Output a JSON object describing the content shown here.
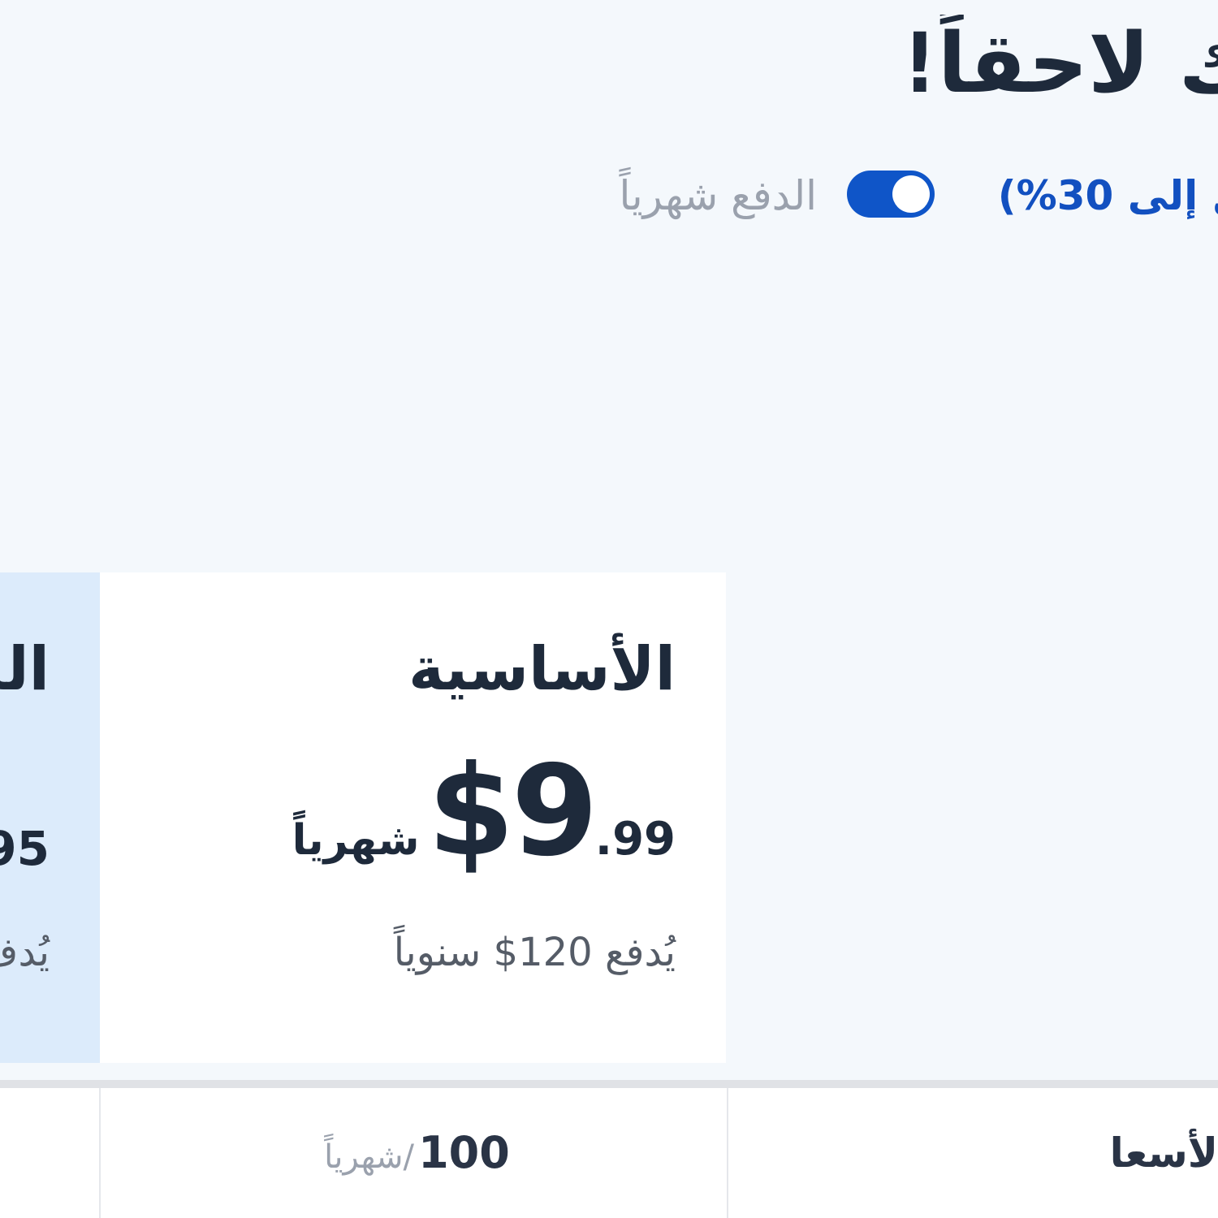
{
  "header": {
    "title": "ك لاحقاً!"
  },
  "billing_toggle": {
    "monthly_label": "الدفع شهرياً",
    "yearly_label": "ل إلى 30%)",
    "enabled": true,
    "accent_color": "#0f55c8"
  },
  "plans": [
    {
      "name": "الأساسية",
      "price_main": "$9",
      "price_cents": ".99",
      "period": "شهرياً",
      "billed_note": "يُدفع 120$ سنوياً"
    },
    {
      "name": "الم",
      "price_fragment": "95",
      "billed_fragment": "يُدف"
    }
  ],
  "comparison_table": {
    "row_label": "لأسعار",
    "basic_value": "100",
    "basic_unit": "/شهرياً"
  }
}
